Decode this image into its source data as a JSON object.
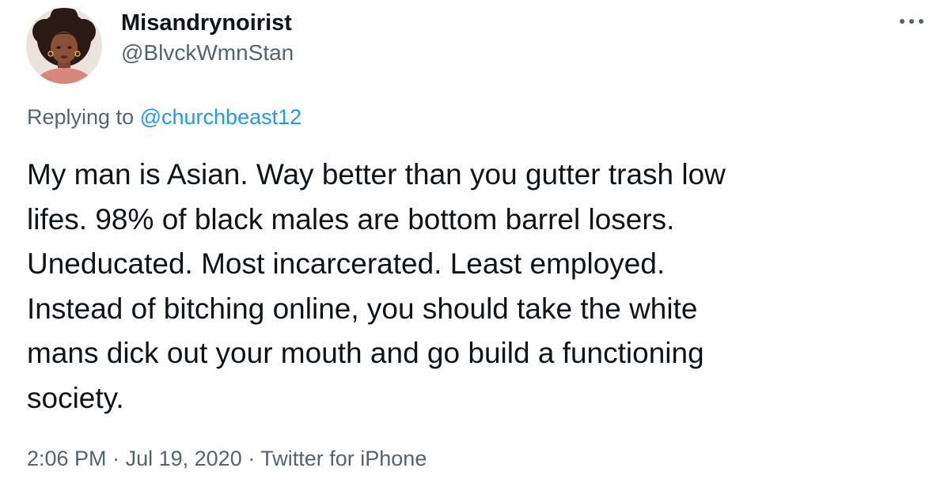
{
  "user": {
    "display_name": "Misandrynoirist",
    "handle": "@BlvckWmnStan",
    "avatar_icon": "avatar-illustration-icon"
  },
  "menu": {
    "icon": "more-horizontal-icon"
  },
  "reply": {
    "prefix": "Replying to",
    "target": "@churchbeast12"
  },
  "tweet": {
    "text": "My man is Asian. Way better than you gutter trash low\nlifes. 98% of black males are bottom barrel losers.\nUneducated. Most incarcerated. Least employed.\nInstead of bitching online, you should take the white\nmans dick out your mouth and go build a functioning\nsociety."
  },
  "meta": {
    "time": "2:06 PM",
    "separator": "·",
    "date": "Jul 19, 2020",
    "source": "Twitter for iPhone"
  },
  "colors": {
    "text": "#0f1419",
    "secondary": "#536471",
    "link": "#1d9bf0",
    "background": "#ffffff"
  }
}
